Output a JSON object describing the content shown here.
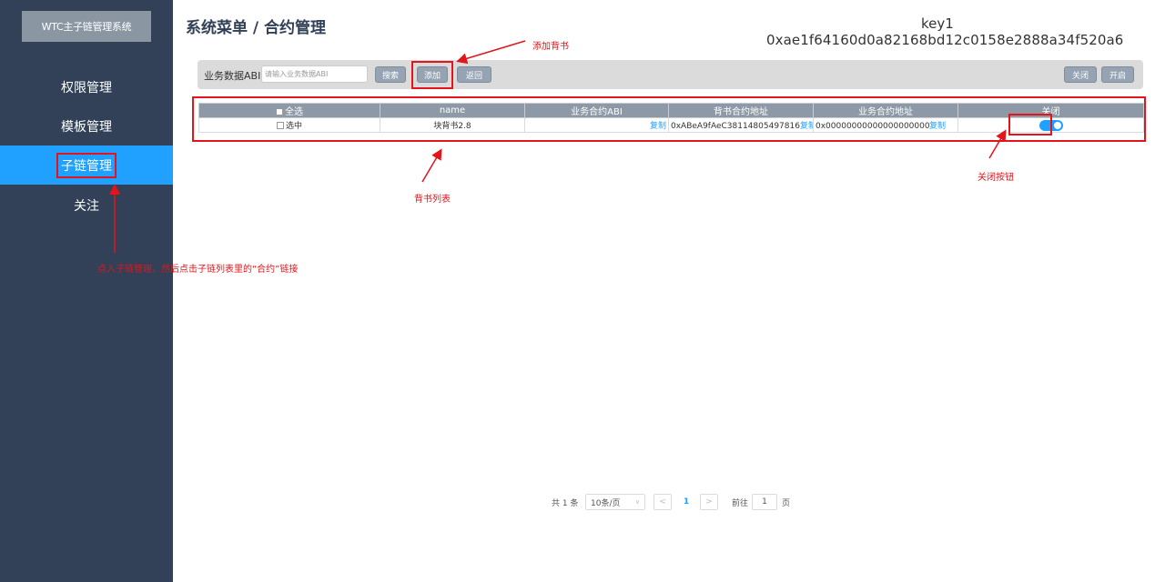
{
  "app": {
    "title": "WTC主子链管理系统"
  },
  "sidebar": {
    "items": [
      {
        "label": "权限管理"
      },
      {
        "label": "模板管理"
      },
      {
        "label": "子链管理"
      },
      {
        "label": "关注"
      }
    ]
  },
  "header": {
    "title": "系统菜单 / 合约管理",
    "key_name": "key1",
    "key_value": "0xae1f64160d0a82168bd12c0158e2888a34f520a6"
  },
  "toolbar": {
    "search_label": "业务数据ABI:",
    "search_placeholder": "请输入业务数据ABI",
    "search_btn": "搜索",
    "add_btn": "添加",
    "back_btn": "返回",
    "close_btn": "关闭",
    "open_btn": "开启"
  },
  "table": {
    "headers": [
      "全选",
      "name",
      "业务合约ABI",
      "背书合约地址",
      "业务合约地址",
      "关闭"
    ],
    "rows": [
      {
        "select": "选中",
        "name": "块背书2.8",
        "abi_copy": "复制",
        "endorse_addr": "0xABeA9fAeC38114805497816",
        "endorse_copy": "复制",
        "biz_addr": "0x0000000000000000000000000",
        "biz_copy": "复制",
        "toggle_on": true
      }
    ]
  },
  "pagination": {
    "total": "共 1 条",
    "page_size": "10条/页",
    "prev": "<",
    "current_page": "1",
    "next": ">",
    "goto_label": "前往",
    "goto_value": "1",
    "page_suffix": "页"
  },
  "annotations": {
    "add_endorse": "添加背书",
    "endorse_list": "背书列表",
    "close_button": "关闭按钮",
    "sidebar_hint": "点入子链管理，然后点击子链列表里的“合约”链接"
  },
  "colors": {
    "sidebar_bg": "#324157",
    "accent": "#20a0ff",
    "annotation_red": "#e3141a"
  }
}
